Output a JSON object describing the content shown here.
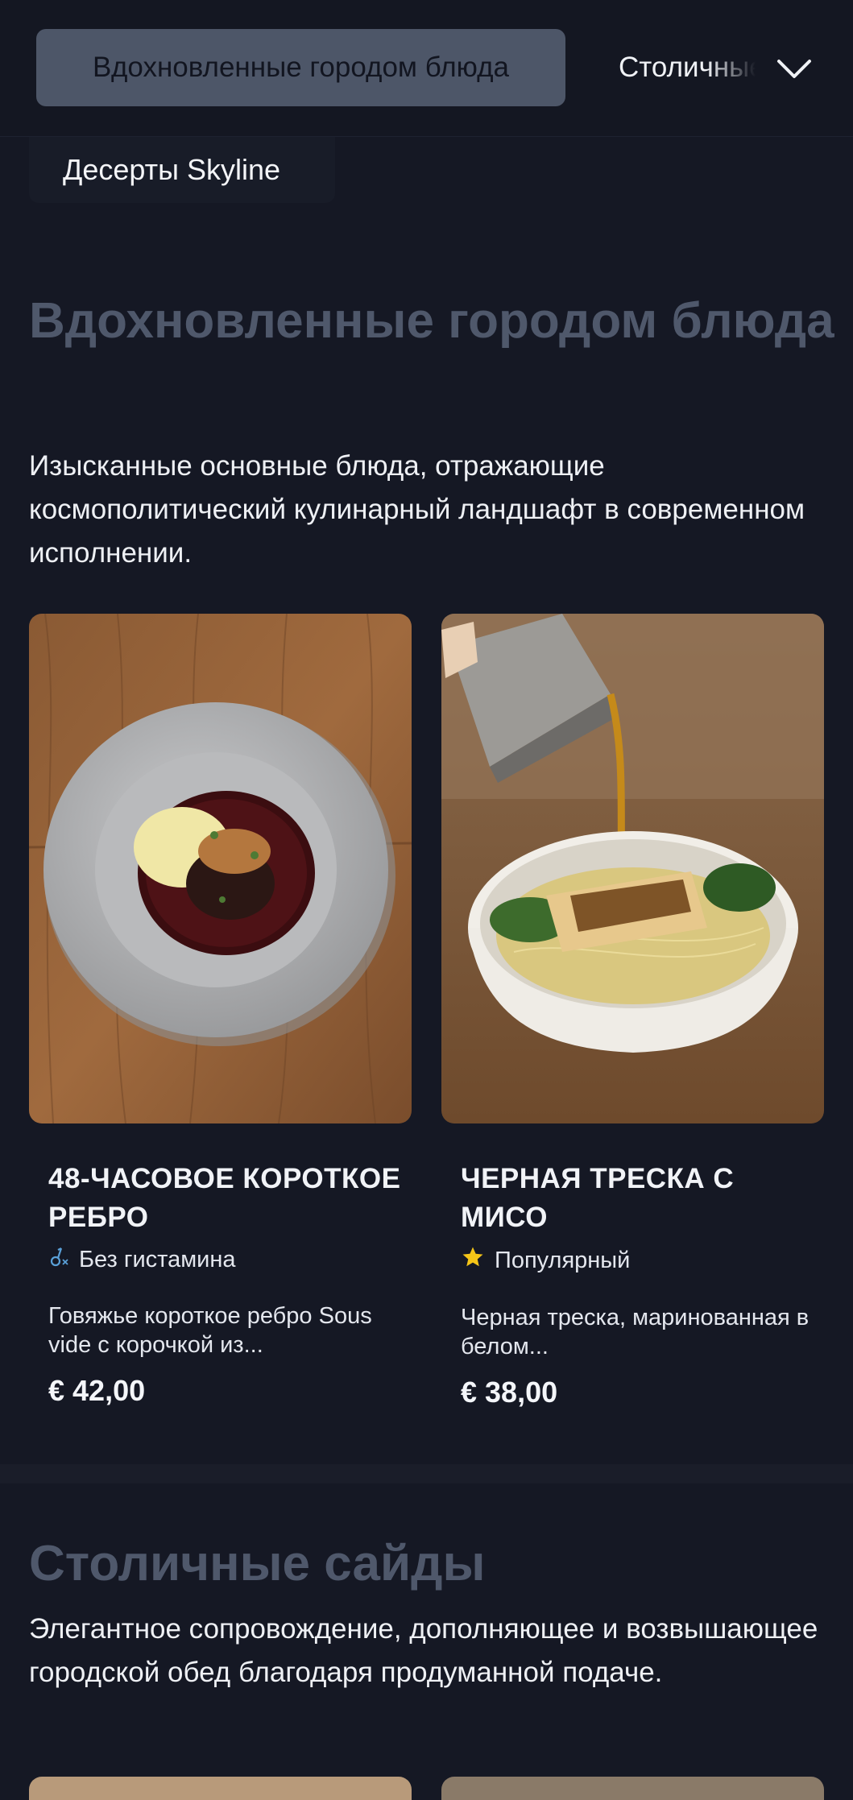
{
  "nav": {
    "active_label": "Вдохновленные городом блюда",
    "next_label": "Столичные сайды"
  },
  "chip": {
    "label": "Десерты Skyline"
  },
  "sections": [
    {
      "title": "Вдохновленные городом блюда",
      "description": "Изысканные основные блюда, отражающие космополитический кулинарный ландшафт в современном исполнении.",
      "items": [
        {
          "name": "48-ЧАСОВОЕ КОРОТКОЕ РЕБРО",
          "badge": "Без гистамина",
          "badge_icon": "histamine-free-icon",
          "description": "Говяжье короткое ребро Sous vide с корочкой из...",
          "price": "€ 42,00",
          "image": "braised-short-rib-plate"
        },
        {
          "name": "ЧЕРНАЯ ТРЕСКА С МИСО",
          "badge": "Популярный",
          "badge_icon": "star-icon",
          "description": "Черная треска, маринованная в белом...",
          "price": "€ 38,00",
          "image": "miso-cod-noodle-bowl"
        }
      ]
    },
    {
      "title": "Столичные сайды",
      "description": "Элегантное сопровождение, дополняющее и возвышающее городской обед благодаря продуманной подаче."
    }
  ],
  "colors": {
    "background": "#151824",
    "nav_active": "#4d5668",
    "section_title": "#4f586b",
    "star": "#f5c518",
    "histamine_icon": "#5aa0d8"
  }
}
